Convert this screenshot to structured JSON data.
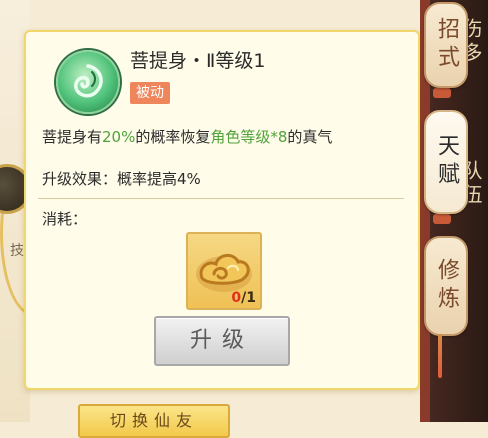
{
  "skill": {
    "title": "菩提身・Ⅱ等级1",
    "tag": "被动",
    "desc_parts": [
      "菩提身有",
      "20%",
      "的概率恢复",
      "角色等级*8",
      "的真气"
    ],
    "upgrade_label": "升级效果：",
    "upgrade_value": "概率提高4%",
    "cost_label": "消耗：",
    "cost_have": "0",
    "cost_sep": "/",
    "cost_need": "1",
    "upgrade_button": "升级",
    "icon": "green-leaf-swirl-icon",
    "tag_color": "#ee855b",
    "highlight_color": "#4fa33a"
  },
  "side_tabs": [
    {
      "label": "招式",
      "active": false
    },
    {
      "label": "天赋",
      "active": true
    },
    {
      "label": "修炼",
      "active": false
    }
  ],
  "background": {
    "right_text_1": "伤多",
    "right_text_2": "队伍",
    "left_label": "技",
    "bottom_button": "切换仙友"
  }
}
